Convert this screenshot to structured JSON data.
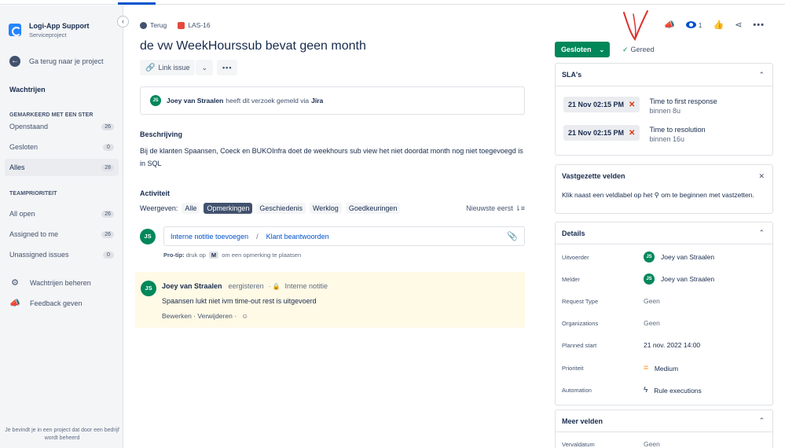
{
  "sidebar": {
    "project_name": "Logi-App Support",
    "project_type": "Serviceproject",
    "back_label": "Ga terug naar je project",
    "queues_title": "Wachtrijen",
    "starred_section": "GEMARKEERD MET EEN STER",
    "starred_items": [
      {
        "label": "Openstaand",
        "count": "26"
      },
      {
        "label": "Gesloten",
        "count": "0"
      },
      {
        "label": "Alles",
        "count": "28"
      }
    ],
    "team_section": "TEAMPRIORITEIT",
    "team_items": [
      {
        "label": "All open",
        "count": "26"
      },
      {
        "label": "Assigned to me",
        "count": "26"
      },
      {
        "label": "Unassigned issues",
        "count": "0"
      }
    ],
    "manage_queues": "Wachtrijen beheren",
    "feedback": "Feedback geven",
    "footer": "Je bevindt je in een project dat door een bedrijf wordt beheerd"
  },
  "breadcrumb": {
    "back": "Terug",
    "issue_key": "LAS-16"
  },
  "issue": {
    "title": "de vw WeekHourssub bevat geen month",
    "link_issue": "Link issue",
    "reporter_initials": "JS",
    "reporter_name": "Joey van Straalen",
    "reporter_text": "heeft dit verzoek gemeld via",
    "reporter_channel": "Jira",
    "description_label": "Beschrijving",
    "description": "Bij de klanten Spaansen, Coeck en BUKOInfra doet de weekhours sub view het niet doordat month nog niet toegevoegd is in SQL"
  },
  "activity": {
    "title": "Activiteit",
    "show_label": "Weergeven:",
    "filters": [
      "Alle",
      "Opmerkingen",
      "Geschiedenis",
      "Werklog",
      "Goedkeuringen"
    ],
    "sort": "Nieuwste eerst ⇂≡",
    "internal_note": "Interne notitie toevoegen",
    "reply_customer": "Klant beantwoorden",
    "protip_label": "Pro-tip:",
    "protip_pre": "druk op",
    "protip_key": "M",
    "protip_post": "om een opmerking te plaatsen"
  },
  "comment": {
    "author": "Joey van Straalen",
    "time": "eergisteren",
    "visibility": "Interne notitie",
    "body": "Spaansen lukt niet ivm time-out rest is uitgevoerd",
    "edit": "Bewerken",
    "delete": "Verwijderen"
  },
  "header_actions": {
    "watch_count": "1"
  },
  "status": {
    "label": "Gesloten",
    "resolution": "Gereed"
  },
  "sla": {
    "title": "SLA's",
    "items": [
      {
        "badge": "21 Nov 02:15 PM",
        "name": "Time to first response",
        "sub": "binnen 8u"
      },
      {
        "badge": "21 Nov 02:15 PM",
        "name": "Time to resolution",
        "sub": "binnen 16u"
      }
    ]
  },
  "pinned": {
    "title": "Vastgezette velden",
    "text": "Klik naast een veldlabel op het ⚲ om te beginnen met vastzetten."
  },
  "details": {
    "title": "Details",
    "rows": [
      {
        "label": "Uitvoerder",
        "value": "Joey van Straalen"
      },
      {
        "label": "Melder",
        "value": "Joey van Straalen"
      },
      {
        "label": "Request Type",
        "value": "Geen"
      },
      {
        "label": "Organizations",
        "value": "Geen"
      },
      {
        "label": "Planned start",
        "value": "21 nov. 2022 14:00"
      },
      {
        "label": "Prioriteit",
        "value": "Medium"
      },
      {
        "label": "Automation",
        "value": "Rule executions"
      }
    ]
  },
  "more_fields": {
    "title": "Meer velden",
    "rows": [
      {
        "label": "Vervaldatum",
        "value": "Geen"
      }
    ]
  },
  "colors": {
    "accent": "#0052cc",
    "status_green": "#00875a",
    "sla_red": "#de350b",
    "note_bg": "#fffae6"
  }
}
